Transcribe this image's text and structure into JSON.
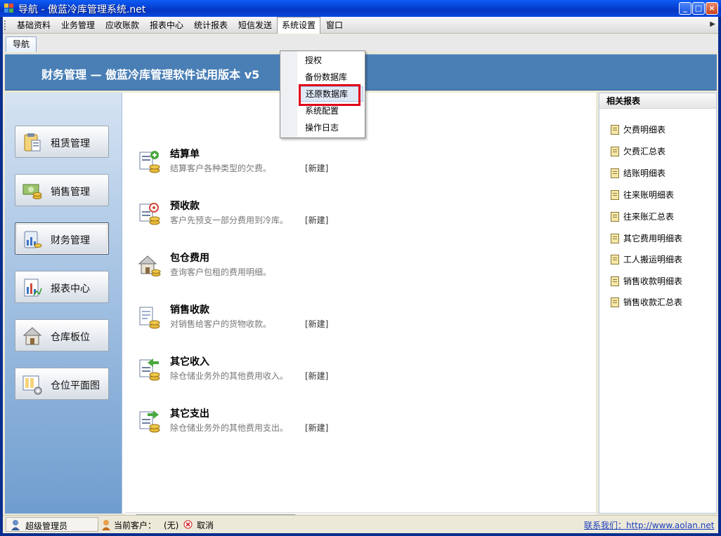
{
  "window": {
    "title": "导航 - 傲蓝冷库管理系统.net",
    "minimize": "_",
    "maximize": "□",
    "close": "×"
  },
  "menu": [
    {
      "label": "基础资料"
    },
    {
      "label": "业务管理"
    },
    {
      "label": "应收账款"
    },
    {
      "label": "报表中心"
    },
    {
      "label": "统计报表"
    },
    {
      "label": "短信发送"
    },
    {
      "label": "系统设置"
    },
    {
      "label": "窗口"
    }
  ],
  "tabs": [
    {
      "label": "导航"
    }
  ],
  "banner": {
    "title": "财务管理 — 傲蓝冷库管理软件试用版本 v5"
  },
  "nav": [
    {
      "label": "租赁管理",
      "icon": "clipboard-icon"
    },
    {
      "label": "销售管理",
      "icon": "money-icon"
    },
    {
      "label": "财务管理",
      "icon": "finance-icon"
    },
    {
      "label": "报表中心",
      "icon": "report-chart-icon"
    },
    {
      "label": "仓库板位",
      "icon": "house-icon"
    },
    {
      "label": "仓位平面图",
      "icon": "floorplan-icon"
    }
  ],
  "items": [
    {
      "title": "结算单",
      "desc": "结算客户各种类型的欠费。",
      "new": "[新建]",
      "icon": "settlement-icon"
    },
    {
      "title": "预收款",
      "desc": "客户先预支一部分费用到冷库。",
      "new": "[新建]",
      "icon": "prepay-icon"
    },
    {
      "title": "包仓费用",
      "desc": "查询客户包租的费用明细。",
      "new": "",
      "icon": "house-fee-icon"
    },
    {
      "title": "销售收款",
      "desc": "对销售给客户的货物收款。",
      "new": "[新建]",
      "icon": "sales-receipt-icon"
    },
    {
      "title": "其它收入",
      "desc": "除仓储业务外的其他费用收入。",
      "new": "[新建]",
      "icon": "income-icon"
    },
    {
      "title": "其它支出",
      "desc": "除仓储业务外的其他费用支出。",
      "new": "[新建]",
      "icon": "expense-icon"
    }
  ],
  "reports": {
    "header": "相关报表",
    "items": [
      "欠费明细表",
      "欠费汇总表",
      "结账明细表",
      "往来账明细表",
      "往来账汇总表",
      "其它费用明细表",
      "工人搬运明细表",
      "销售收款明细表",
      "销售收款汇总表"
    ]
  },
  "dropdown": {
    "items": [
      "授权",
      "备份数据库",
      "还原数据库",
      "系统配置",
      "操作日志"
    ],
    "highlighted": "还原数据库"
  },
  "status": {
    "user": "超级管理员",
    "customer_label": "当前客户：",
    "customer_value": "(无)",
    "cancel": "取消",
    "contact_link": "联系我们：http://www.aolan.net"
  },
  "colors": {
    "banner": "#4a7fb6",
    "titlebar": "#0743d6",
    "highlight_box": "#e0001b"
  }
}
